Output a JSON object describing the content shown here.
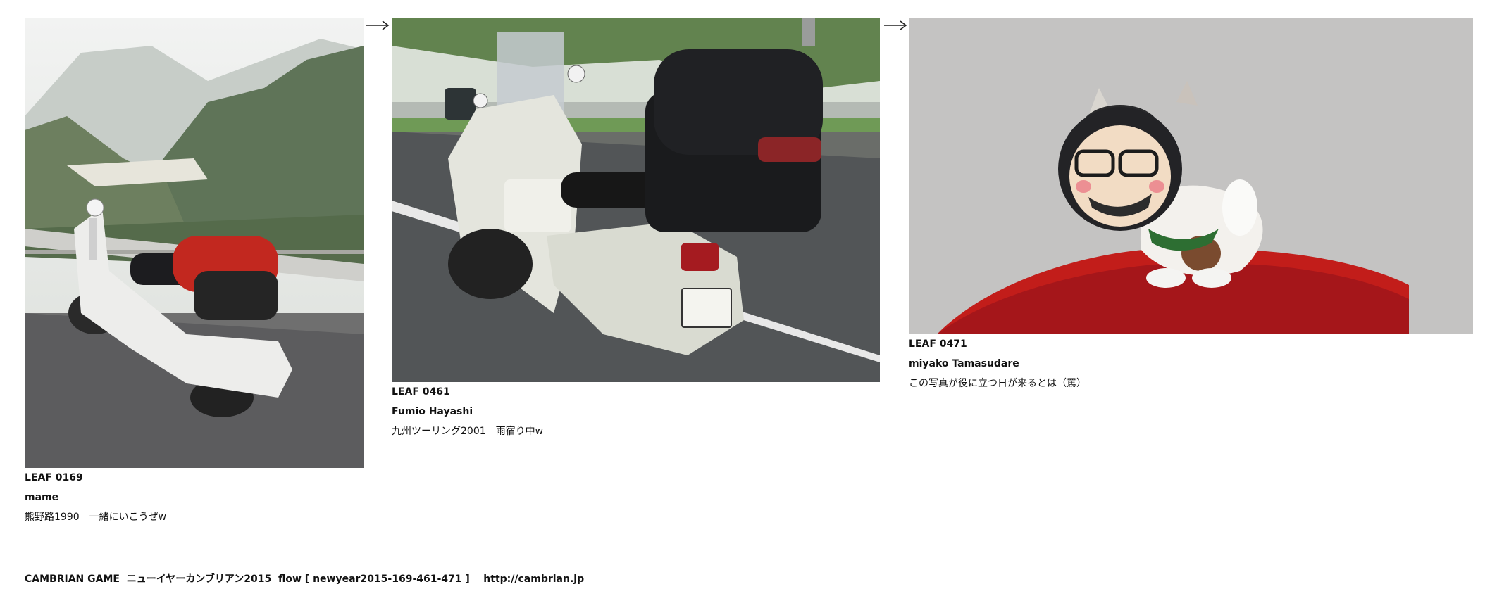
{
  "leaves": [
    {
      "id": "LEAF 0169",
      "author": "mame",
      "note": "熊野路1990　一緒にいこうぜw",
      "photo_subject": "white scooter with red bag parked by mountain guardrail"
    },
    {
      "id": "LEAF 0461",
      "author": "Fumio Hayashi",
      "note": "九州ツーリング2001　雨宿り中w",
      "photo_subject": "white scooter with windshield and black luggage on wet road"
    },
    {
      "id": "LEAF 0471",
      "author": "miyako Tamasudare",
      "note": "この写真が役に立つ日が来るとは（罵）",
      "photo_subject": "plush dog doll with a glasses face on red cushion"
    }
  ],
  "footer": {
    "text": "CAMBRIAN GAME  ニューイヤーカンブリアン2015  flow [ newyear2015-169-461-471 ]    http://cambrian.jp"
  },
  "icons": {
    "arrow": "right-arrow-icon"
  },
  "colors": {
    "background": "#ffffff",
    "text": "#111111"
  }
}
